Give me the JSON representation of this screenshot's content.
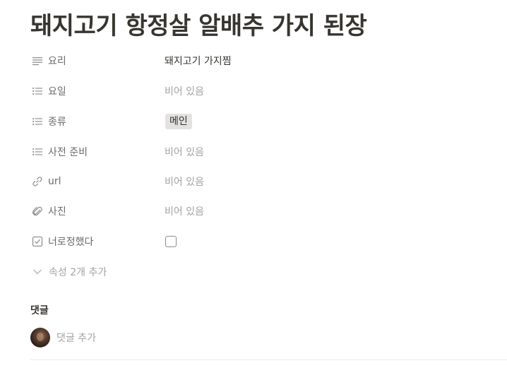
{
  "page": {
    "title": "돼지고기 항정살 알배추 가지 된장"
  },
  "properties": [
    {
      "name": "요리",
      "icon": "text-lines-icon",
      "value": "돼지고기 가지찜",
      "kind": "text"
    },
    {
      "name": "요일",
      "icon": "multi-select-list-icon",
      "value": "비어 있음",
      "kind": "empty"
    },
    {
      "name": "종류",
      "icon": "multi-select-list-icon",
      "value": "메인",
      "kind": "tag"
    },
    {
      "name": "사전 준비",
      "icon": "multi-select-list-icon",
      "value": "비어 있음",
      "kind": "empty"
    },
    {
      "name": "url",
      "icon": "link-icon",
      "value": "비어 있음",
      "kind": "empty"
    },
    {
      "name": "사진",
      "icon": "paperclip-icon",
      "value": "비어 있음",
      "kind": "empty"
    },
    {
      "name": "너로정했다",
      "icon": "checkbox-icon",
      "value": false,
      "kind": "checkbox"
    }
  ],
  "more_properties": {
    "label": "속성 2개 추가",
    "icon": "chevron-down-icon"
  },
  "comments": {
    "heading": "댓글",
    "placeholder": "댓글 추가",
    "avatar_icon": "user-avatar"
  },
  "colors": {
    "text": "#37352f",
    "muted": "#6b6b6b",
    "placeholder": "#a3a29e",
    "tag_bg": "#e3e2e0"
  }
}
